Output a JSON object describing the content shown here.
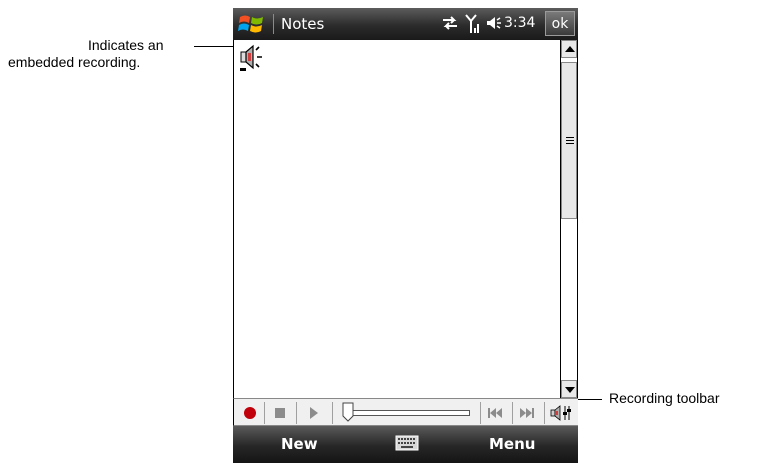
{
  "callouts": {
    "embedded_recording": [
      "Indicates an",
      "embedded recording."
    ],
    "recording_toolbar": "Recording toolbar"
  },
  "titlebar": {
    "start_icon": "windows-flag-icon",
    "app_title": "Notes",
    "status_icons": [
      "connectivity-icon",
      "signal-icon",
      "volume-icon"
    ],
    "time": "3:34",
    "ok_label": "ok"
  },
  "document": {
    "embedded_item_icon": "speaker-recording-icon"
  },
  "recording_toolbar": {
    "buttons": [
      "record-icon",
      "stop-icon",
      "play-icon",
      "rewind-icon",
      "fast-forward-icon",
      "volume-icon"
    ],
    "position": 0
  },
  "softkeys": {
    "left": "New",
    "center_icon": "keyboard-icon",
    "right": "Menu"
  },
  "colors": {
    "titlebar": "#2b2b2b",
    "record": "#c0000a",
    "ok_button": "#4a4a4a"
  }
}
